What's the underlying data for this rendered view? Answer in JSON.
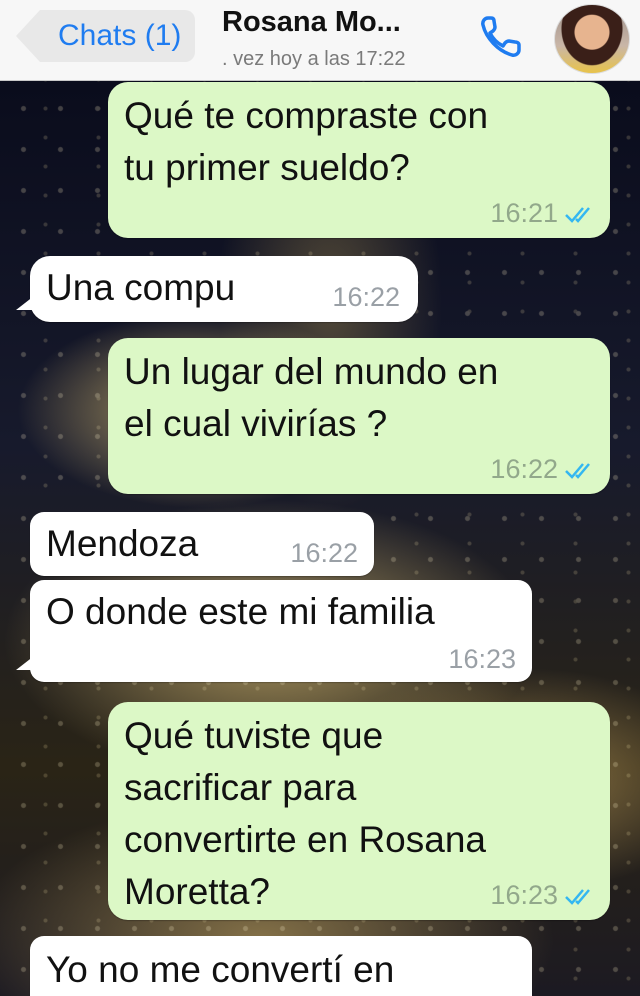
{
  "header": {
    "back_label": "Chats (1)",
    "contact_name": "Rosana  Mo...",
    "last_seen": ". vez hoy a las 17:22"
  },
  "colors": {
    "accent": "#1f7cf0",
    "outgoing_bubble": "#dcf8c6",
    "incoming_bubble": "#ffffff",
    "read_ticks": "#34b7f1"
  },
  "messages": [
    {
      "direction": "outgoing",
      "text": "Qué te compraste con\ntu primer sueldo?",
      "time": "16:21",
      "status": "read"
    },
    {
      "direction": "incoming",
      "text": "Una compu",
      "time": "16:22"
    },
    {
      "direction": "outgoing",
      "text": "Un lugar del mundo en\nel cual vivirías ?",
      "time": "16:22",
      "status": "read"
    },
    {
      "direction": "incoming",
      "text": "Mendoza",
      "time": "16:22"
    },
    {
      "direction": "incoming",
      "text": "O donde este mi familia",
      "time": "16:23"
    },
    {
      "direction": "outgoing",
      "text": "Qué tuviste que\nsacrificar para\nconvertirte en Rosana\nMoretta?",
      "time": "16:23",
      "status": "read"
    },
    {
      "direction": "incoming",
      "text": "Yo no me convertí en",
      "time": ""
    }
  ],
  "icons": {
    "call": "phone-icon",
    "read_status": "double-check-icon",
    "back": "back-chevron-icon"
  }
}
